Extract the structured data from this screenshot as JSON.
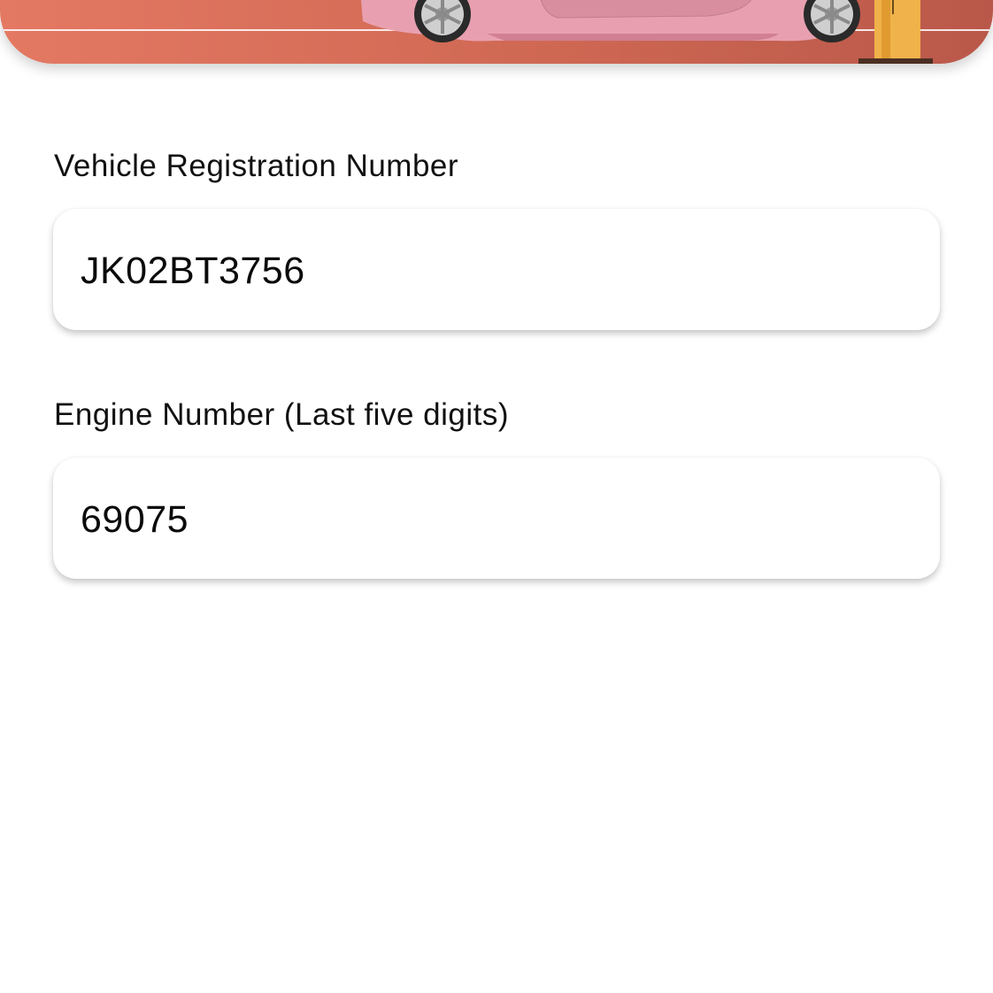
{
  "header": {
    "illustration": "car-at-toll-barrier-illustration",
    "background_gradient": [
      "#e47963",
      "#cf6853",
      "#b9584a"
    ]
  },
  "form": {
    "registration": {
      "label": "Vehicle Registration Number",
      "value": "JK02BT3756"
    },
    "engine": {
      "label": "Engine Number (Last five digits)",
      "value": "69075"
    }
  }
}
